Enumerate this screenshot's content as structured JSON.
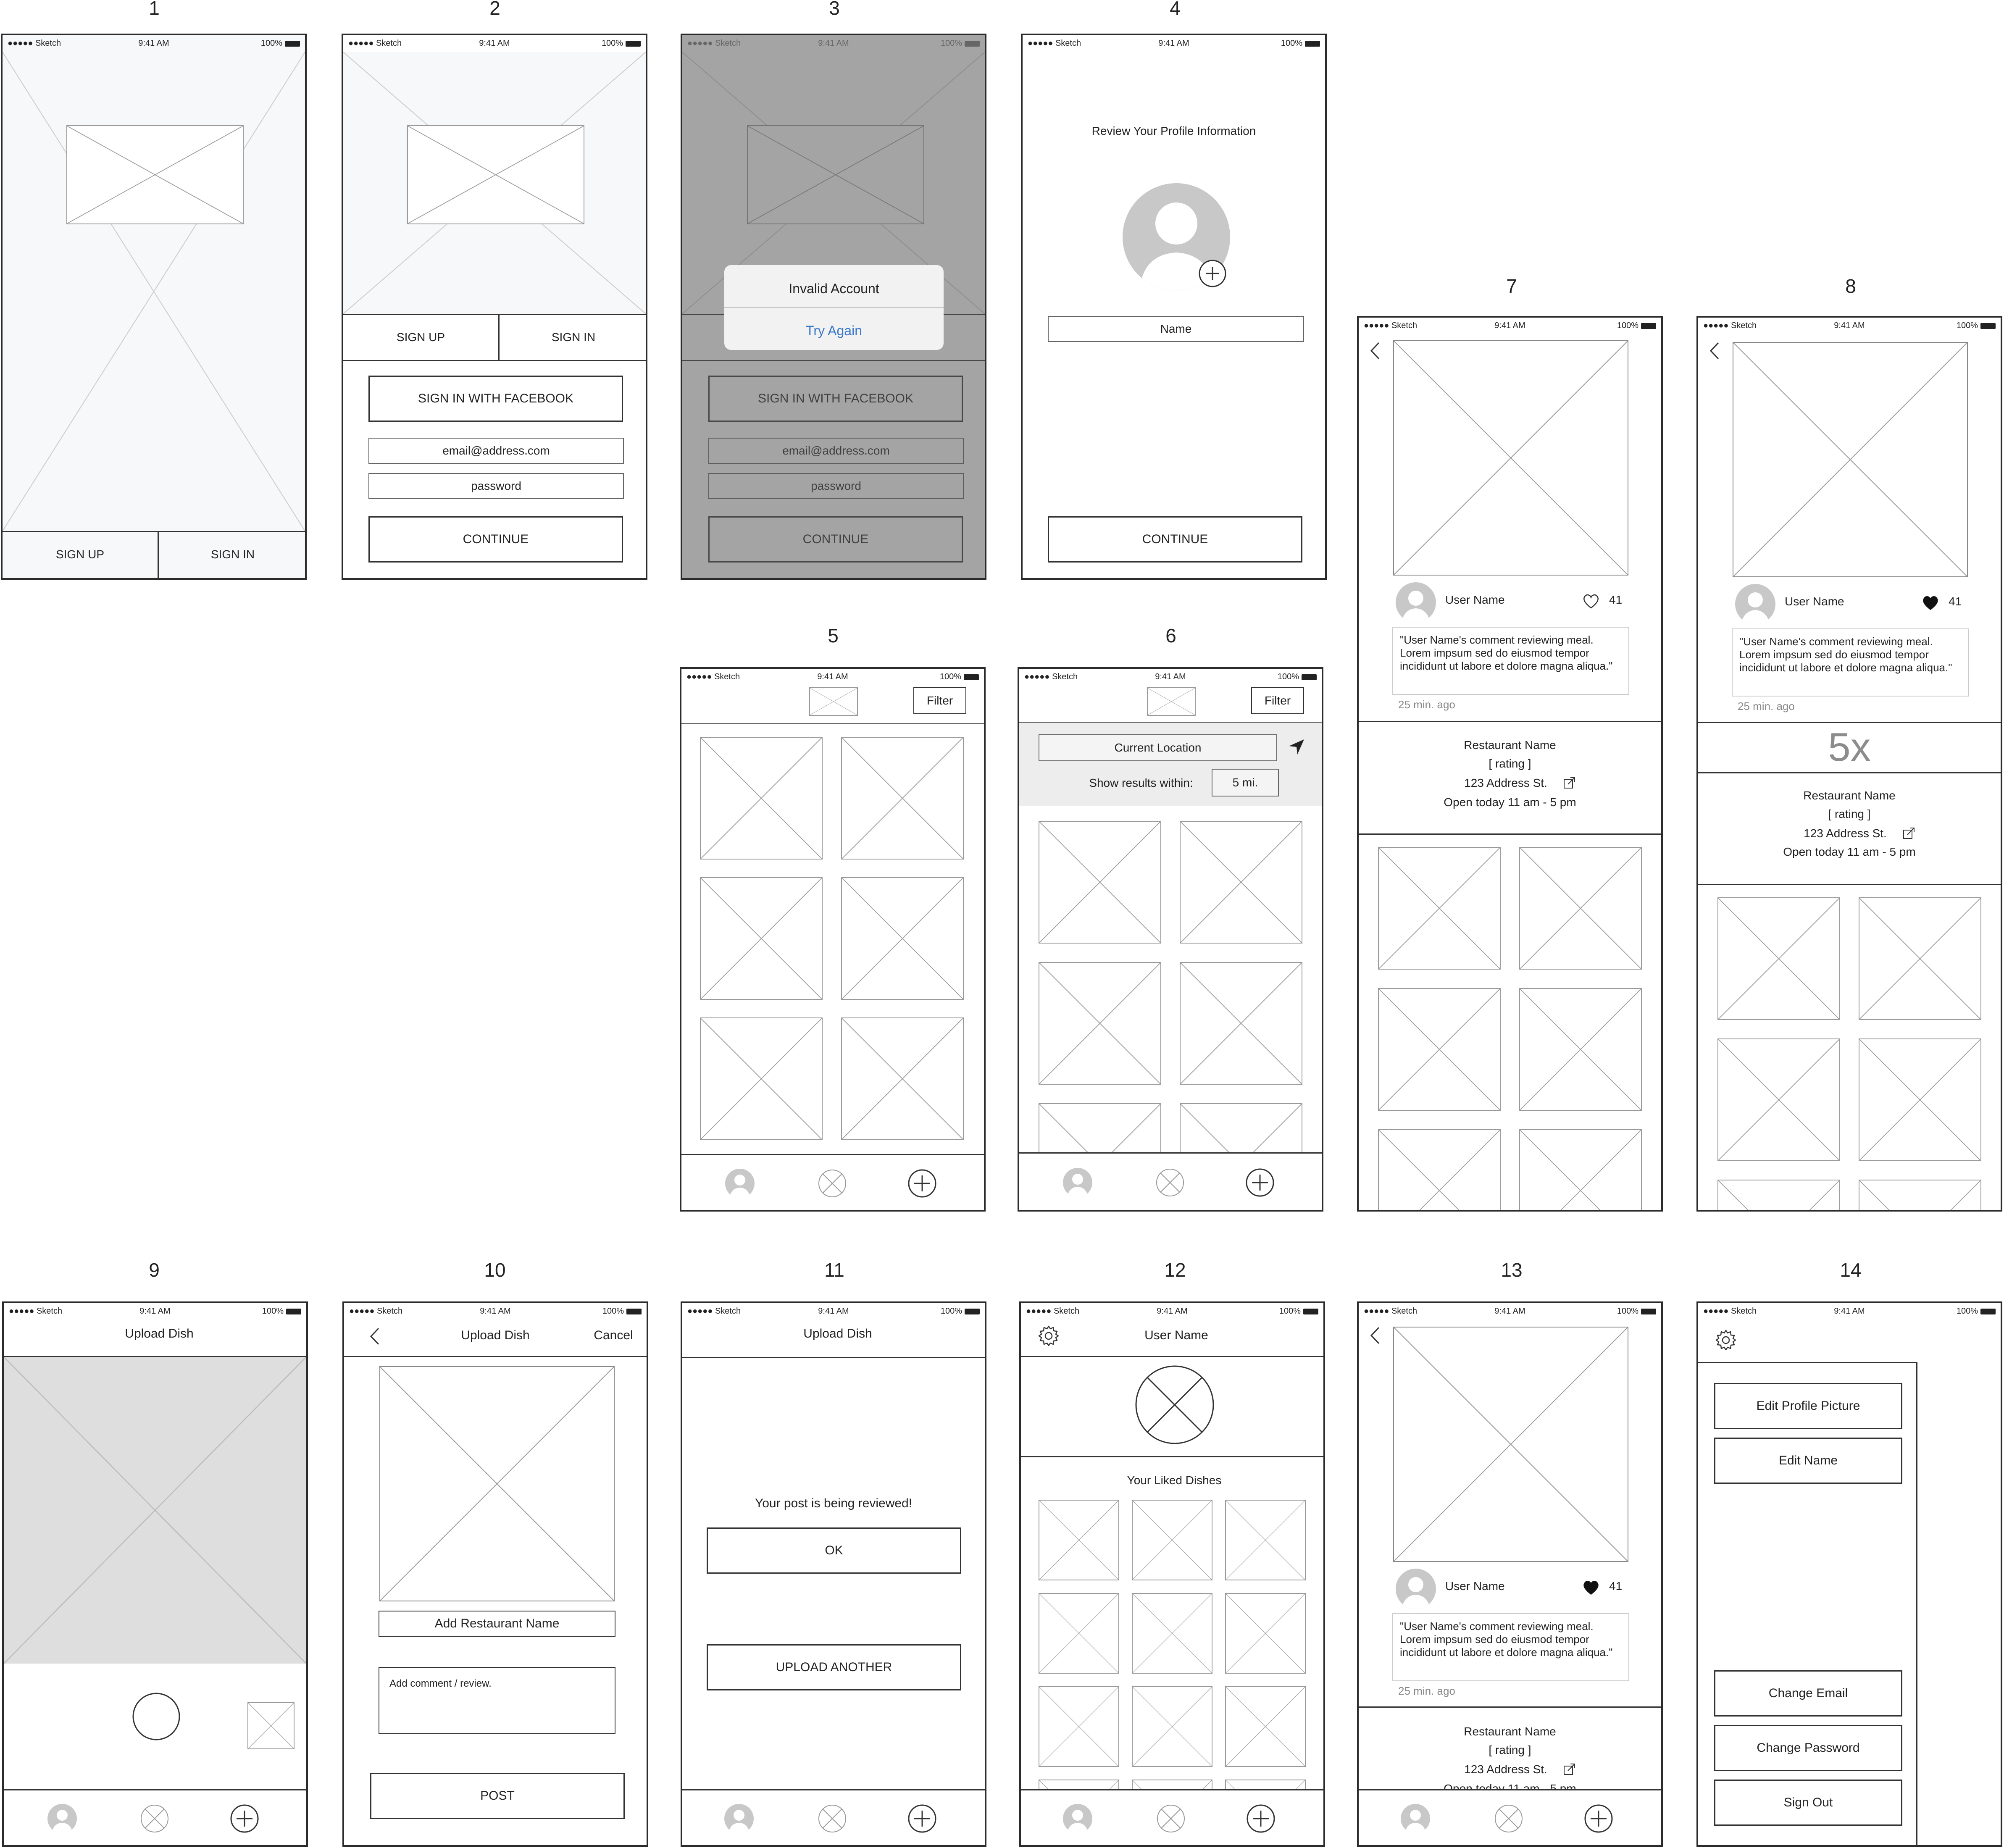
{
  "screen_numbers": [
    "1",
    "2",
    "3",
    "4",
    "5",
    "6",
    "7",
    "8",
    "9",
    "10",
    "11",
    "12",
    "13",
    "14"
  ],
  "status_bar": {
    "carrier": "●●●●● Sketch",
    "time": "9:41 AM",
    "battery": "100%"
  },
  "auth": {
    "sign_up": "SIGN UP",
    "sign_in": "SIGN IN",
    "facebook": "SIGN IN WITH FACEBOOK",
    "email_placeholder": "email@address.com",
    "password_placeholder": "password",
    "continue": "CONTINUE"
  },
  "alert": {
    "title": "Invalid Account",
    "action": "Try Again"
  },
  "profile_setup": {
    "title": "Review Your Profile Information",
    "name_field": "Name",
    "continue": "CONTINUE"
  },
  "feed": {
    "filter": "Filter"
  },
  "location_filter": {
    "current_location": "Current Location",
    "show_within_label": "Show results within:",
    "distance": "5 mi."
  },
  "post": {
    "user_name": "User Name",
    "likes": "41",
    "comment": "\"User Name's comment reviewing meal. Lorem impsum sed do eiusmod tempor incididunt ut labore et dolore magna aliqua.\"",
    "time_ago": "25 min. ago",
    "restaurant_name": "Restaurant Name",
    "rating": "[ rating ]",
    "address": "123 Address St.",
    "hours": "Open today 11 am - 5 pm",
    "multiplier": "5x"
  },
  "upload": {
    "title": "Upload Dish",
    "cancel": "Cancel",
    "add_restaurant": "Add Restaurant Name",
    "add_comment": "Add comment / review.",
    "post": "POST",
    "reviewing": "Your post is being reviewed!",
    "ok": "OK",
    "upload_another": "UPLOAD ANOTHER"
  },
  "profile": {
    "user_name": "User Name",
    "liked_dishes": "Your Liked Dishes"
  },
  "settings_menu": {
    "edit_picture": "Edit Profile Picture",
    "edit_name": "Edit Name",
    "change_email": "Change Email",
    "change_password": "Change Password",
    "sign_out": "Sign Out"
  },
  "colors": {
    "link_blue": "#3a78c8",
    "wire": "#333333",
    "placeholder": "#9a9a9a",
    "dim": "#8c8c8c"
  }
}
